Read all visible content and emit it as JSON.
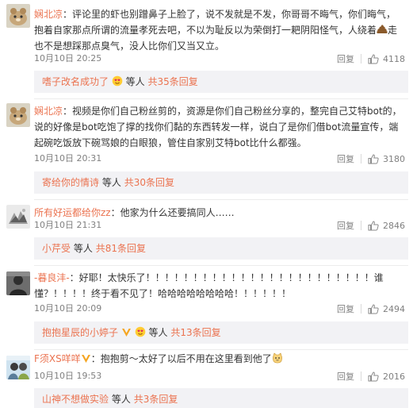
{
  "comments": [
    {
      "username": "娴北凉",
      "text_a": "：评论里的虾也别蹭鼻子上脸了，说不发就是不发，你哥哥不晦气，你们晦气，抱着自家那点所谓的流量孝死去吧，不以为耻反以为荣倒打一耙阴阳怪气，人绕着",
      "text_b": "走也不是想踩那点臭气，没人比你们又当又立。",
      "date": "10月10日 20:25",
      "reply_label": "回复",
      "likes": "4118",
      "replies": {
        "user": "嗜子改名成功了",
        "mid": "等人",
        "count": "共35条回复"
      }
    },
    {
      "username": "娴北凉",
      "text_a": "：视频是你们自己粉丝剪的，资源是你们自己粉丝分享的，整完自己艾特bot的，说的好像是bot吃饱了撑的找你们黏的东西转发一样，说白了是你们借bot流量宣传，端起碗吃饭放下碗骂娘的白眼狼，管住自家别艾特bot比什么都强。",
      "date": "10月10日 20:31",
      "reply_label": "回复",
      "likes": "3180",
      "replies": {
        "user": "寄给你的情诗",
        "mid": "等人",
        "count": "共30条回复"
      }
    },
    {
      "username": "所有好运都给你zz",
      "text_a": "：他家为什么还要搞同人……",
      "date": "10月10日 21:31",
      "reply_label": "回复",
      "likes": "2846",
      "replies": {
        "user": "小芹受",
        "mid": "等人",
        "count": "共81条回复"
      }
    },
    {
      "username": "-暮良沣-",
      "text_a": "：好耶！太快乐了！！！！！！！！！！！！！！！！！！！！！！！！谁懂？！！！！终于看不见了！哈哈哈哈哈哈哈哈！！！！！！",
      "date": "10月10日 20:09",
      "reply_label": "回复",
      "likes": "2494",
      "replies": {
        "user": "抱抱星辰的小婷子",
        "mid": "等人",
        "count": "共13条回复"
      }
    },
    {
      "username": "F须XS咩咩",
      "text_a": "：抱抱剪～太好了以后不用在这里看到他了",
      "date": "10月10日 19:53",
      "reply_label": "回复",
      "likes": "2016",
      "replies": {
        "user": "山神不想做实验",
        "mid": "等人",
        "count": "共3条回复"
      }
    }
  ]
}
